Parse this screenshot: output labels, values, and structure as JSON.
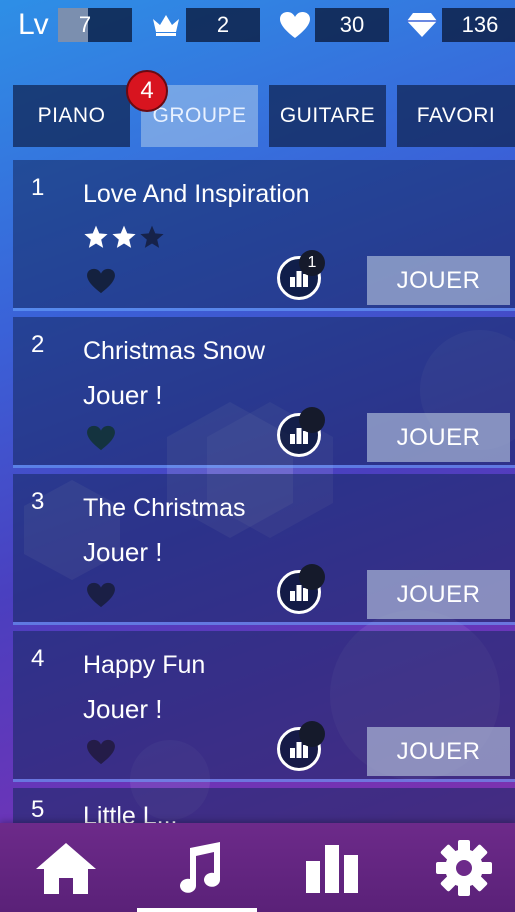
{
  "stats": {
    "level_label": "Lv",
    "level": "7",
    "level_progress_percent": 40,
    "crowns": "2",
    "lives": "30",
    "gems": "136"
  },
  "tabs": [
    {
      "label": "PIANO",
      "active": false
    },
    {
      "label": "GROUPE",
      "active": true,
      "badge": "4"
    },
    {
      "label": "GUITARE",
      "active": false
    },
    {
      "label": "FAVORI",
      "active": false
    }
  ],
  "songs": [
    {
      "number": "1",
      "title": "Love And Inspiration",
      "stars": 2,
      "max_stars": 3,
      "subtitle": "",
      "rank_badge": "1",
      "play_label": "JOUER"
    },
    {
      "number": "2",
      "title": "Christmas Snow",
      "stars": 0,
      "subtitle": "Jouer !",
      "rank_badge": "",
      "play_label": "JOUER"
    },
    {
      "number": "3",
      "title": "The Christmas",
      "stars": 0,
      "subtitle": "Jouer !",
      "rank_badge": "",
      "play_label": "JOUER"
    },
    {
      "number": "4",
      "title": "Happy Fun",
      "stars": 0,
      "subtitle": "Jouer !",
      "rank_badge": "",
      "play_label": "JOUER"
    },
    {
      "number": "5",
      "title": "Little L...",
      "partial": true
    }
  ],
  "nav": [
    {
      "icon": "home-icon",
      "active": false
    },
    {
      "icon": "music-note-icon",
      "active": true
    },
    {
      "icon": "bar-chart-icon",
      "active": false
    },
    {
      "icon": "gear-icon",
      "active": false
    }
  ],
  "colors": {
    "badge_red": "#d8141f",
    "bottom_nav": "#6d2a8a"
  }
}
